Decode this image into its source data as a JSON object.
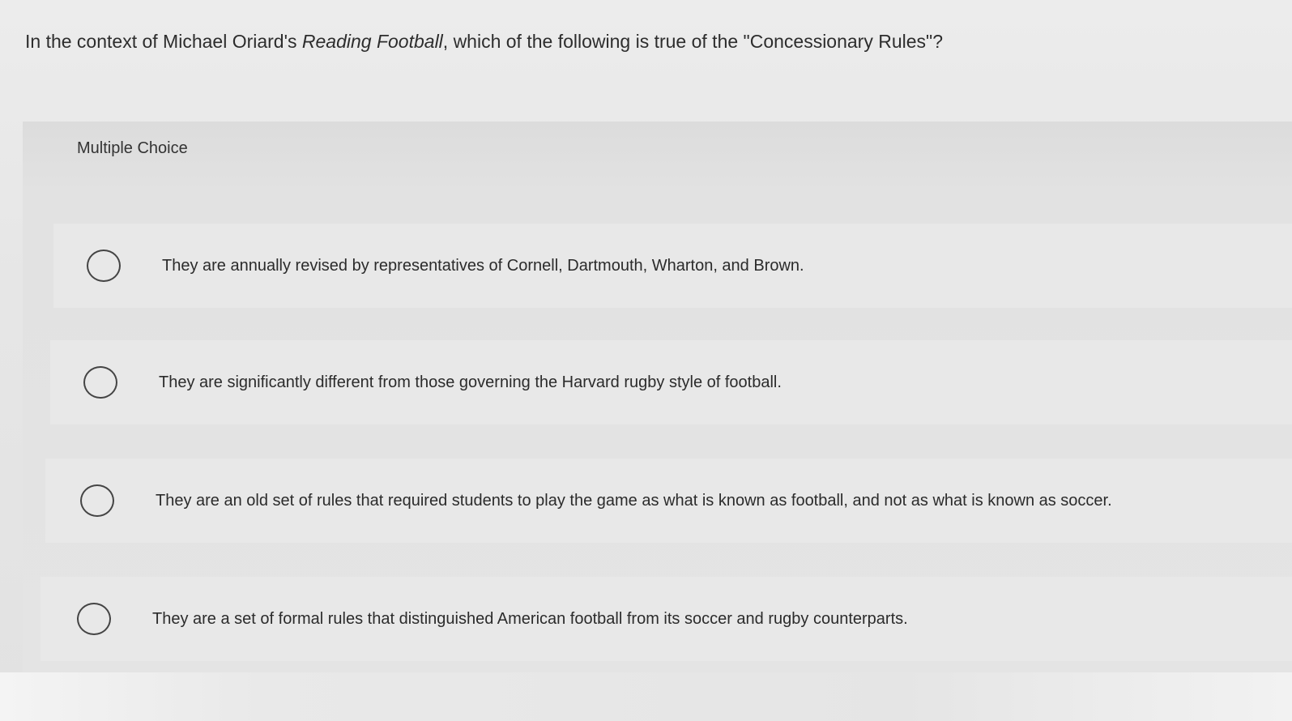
{
  "question": {
    "prefix": "In the context of Michael Oriard's ",
    "book_title": "Reading Football",
    "suffix": ", which of the following is true of the \"Concessionary Rules\"?"
  },
  "answer_type_label": "Multiple Choice",
  "options": [
    {
      "label": "They are annually revised by representatives of Cornell, Dartmouth, Wharton, and Brown.",
      "selected": false
    },
    {
      "label": "They are significantly different from those governing the Harvard rugby style of football.",
      "selected": false
    },
    {
      "label": "They are an old set of rules that required students to play the game as what is known as football, and not as what is known as soccer.",
      "selected": false
    },
    {
      "label": "They are a set of formal rules that distinguished American football from its soccer and rugby counterparts.",
      "selected": false
    }
  ]
}
